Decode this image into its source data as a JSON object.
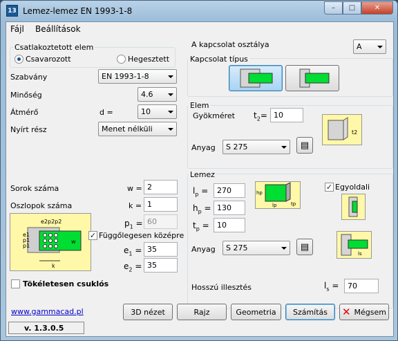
{
  "window": {
    "icon": "13",
    "title": "Lemez-lemez EN 1993-1-8",
    "minimize": "–",
    "maximize": "□",
    "close": "✕"
  },
  "menu": {
    "file": "Fájl",
    "settings": "Beállítások"
  },
  "connection": {
    "group_title": "Csatlakoztetott elem",
    "bolted": "Csavarozott",
    "welded": "Hegesztett",
    "selected": "bolted"
  },
  "left": {
    "standard_label": "Szabvány",
    "standard_value": "EN 1993-1-8",
    "grade_label": "Minőség",
    "grade_value": "4.6",
    "diameter_label": "Átmérő",
    "d_label": "d =",
    "diameter_value": "10",
    "shear_label": "Nyírt rész",
    "shear_value": "Menet nélküli",
    "rows_label": "Sorok száma",
    "w_label": "w =",
    "rows_value": "2",
    "cols_label": "Oszlopok száma",
    "k_label": "k =",
    "cols_value": "1",
    "p1_label": "p",
    "p1_sub": "1",
    "p1_eq": "=",
    "p1_value": "60",
    "vcenter_label": "Függőlegesen középre",
    "vcenter_checked": true,
    "e1_label": "e",
    "e1_sub": "1",
    "e1_eq": "=",
    "e1_value": "35",
    "e2_label": "e",
    "e2_sub": "2",
    "e2_eq": "=",
    "e2_value": "35",
    "pinned_label": "Tökéletesen csuklós",
    "pinned_checked": false,
    "diagram_labels": {
      "e2p2p2": "e2p2p2",
      "e1": "e1",
      "p1a": "p1",
      "p1b": "p1",
      "w": "w",
      "k": "k"
    }
  },
  "right": {
    "class_label": "A kapcsolat osztálya",
    "class_value": "A",
    "type_group": "Kapcsolat típus",
    "element_group": "Elem",
    "throat_label": "Gyökméret",
    "t2_label": "t",
    "t2_sub": "2",
    "t2_eq": "=",
    "t2_value": "10",
    "element_material_label": "Anyag",
    "element_material": "S 275",
    "plate_group": "Lemez",
    "lp_label": "l",
    "lp_sub": "p",
    "lp_eq": "=",
    "lp_value": "270",
    "hp_label": "h",
    "hp_sub": "p",
    "hp_eq": "=",
    "hp_value": "130",
    "tp_label": "t",
    "tp_sub": "p",
    "tp_eq": "=",
    "tp_value": "10",
    "plate_material_label": "Anyag",
    "plate_material": "S 275",
    "onesided_label": "Egyoldali",
    "onesided_checked": true,
    "lap_label": "Hosszú illesztés",
    "ls_label": "l",
    "ls_sub": "s",
    "ls_eq": "=",
    "ls_value": "70",
    "diagram_labels": {
      "hp": "hp",
      "lp": "lp",
      "tp": "tp",
      "t2": "t2",
      "ls": "ls"
    }
  },
  "footer": {
    "link": "www.gammacad.pl",
    "version": "v. 1.3.0.5"
  },
  "buttons": {
    "view3d": "3D nézet",
    "drawing": "Rajz",
    "geometry": "Geometria",
    "calc": "Számítás",
    "cancel": "Mégsem"
  },
  "colors": {
    "plate_green": "#00dd33",
    "diagram_yellow": "#fff8a8",
    "accent": "#3c7fb1"
  }
}
